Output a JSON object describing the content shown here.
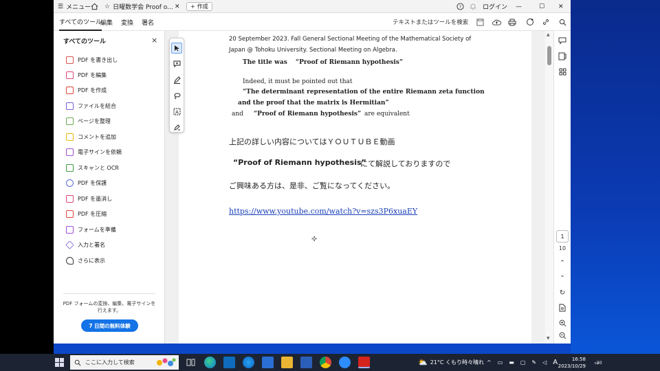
{
  "titlebar": {
    "menu_label": "メニュー",
    "doc_tab_label": "日曜数学会 Proof o...",
    "new_tab_label": "作成",
    "login_label": "ログイン"
  },
  "toolbar": {
    "tabs": [
      "すべてのツール",
      "編集",
      "変換",
      "署名"
    ],
    "search_label": "テキストまたはツールを検索"
  },
  "left_panel": {
    "title": "すべてのツール",
    "items": [
      {
        "label": "PDF を書き出し",
        "color": "#d9534f"
      },
      {
        "label": "PDF を編集",
        "color": "#e0457b"
      },
      {
        "label": "PDF を作成",
        "color": "#e0453c"
      },
      {
        "label": "ファイルを結合",
        "color": "#7b5cd6"
      },
      {
        "label": "ページを整理",
        "color": "#6aa84f"
      },
      {
        "label": "コメントを追加",
        "color": "#e6b800"
      },
      {
        "label": "電子サインを依頼",
        "color": "#9c4fd6"
      },
      {
        "label": "スキャンと OCR",
        "color": "#3c9a3c"
      },
      {
        "label": "PDF を保護",
        "color": "#5b6bd6"
      },
      {
        "label": "PDF を墨消し",
        "color": "#e0457b"
      },
      {
        "label": "PDF を圧縮",
        "color": "#e0453c"
      },
      {
        "label": "フォームを準備",
        "color": "#9c4fd6"
      },
      {
        "label": "入力と署名",
        "color": "#7b5cd6"
      },
      {
        "label": "さらに表示",
        "color": "#333333"
      }
    ],
    "promo_text": "PDF フォームの変換、編集、電子サインを行えます。",
    "trial_button": "7 日間の無料体験"
  },
  "document": {
    "line1": "20 September 2023. Fall General Sectional Meeting of the Mathematical Society of",
    "line2": "Japan @ Tohoku    University. Sectional Meeting on Algebra.",
    "line3": "The title was 　“Proof of Riemann hypothesis”",
    "line4": "Indeed, it must be pointed out that",
    "line5": "“The determinant representation of the entire Riemann zeta function",
    "line6": "and the proof that the matrix is Hermitian”",
    "line7a": "and",
    "line7b": "“Proof of Riemann hypothesis”",
    "line7c": "are equivalent",
    "jp1": "上記の詳しい内容についてはＹＯＵＴＵＢＥ動画",
    "jp2a": "“Proof of Riemann hypothesis”",
    "jp2b": "にて解説しておりますので",
    "jp3": "ご興味ある方は、是非、ご覧になってください。",
    "link": "https://www.youtube.com/watch?v=szs3P6xuaEY"
  },
  "pagination": {
    "current": "1",
    "total": "10"
  },
  "taskbar": {
    "search_placeholder": "ここに入力して検索",
    "weather": "21°C くもり時々晴れ",
    "ime": "A",
    "time": "16:58",
    "date": "2023/10/29",
    "notifications": "20"
  }
}
